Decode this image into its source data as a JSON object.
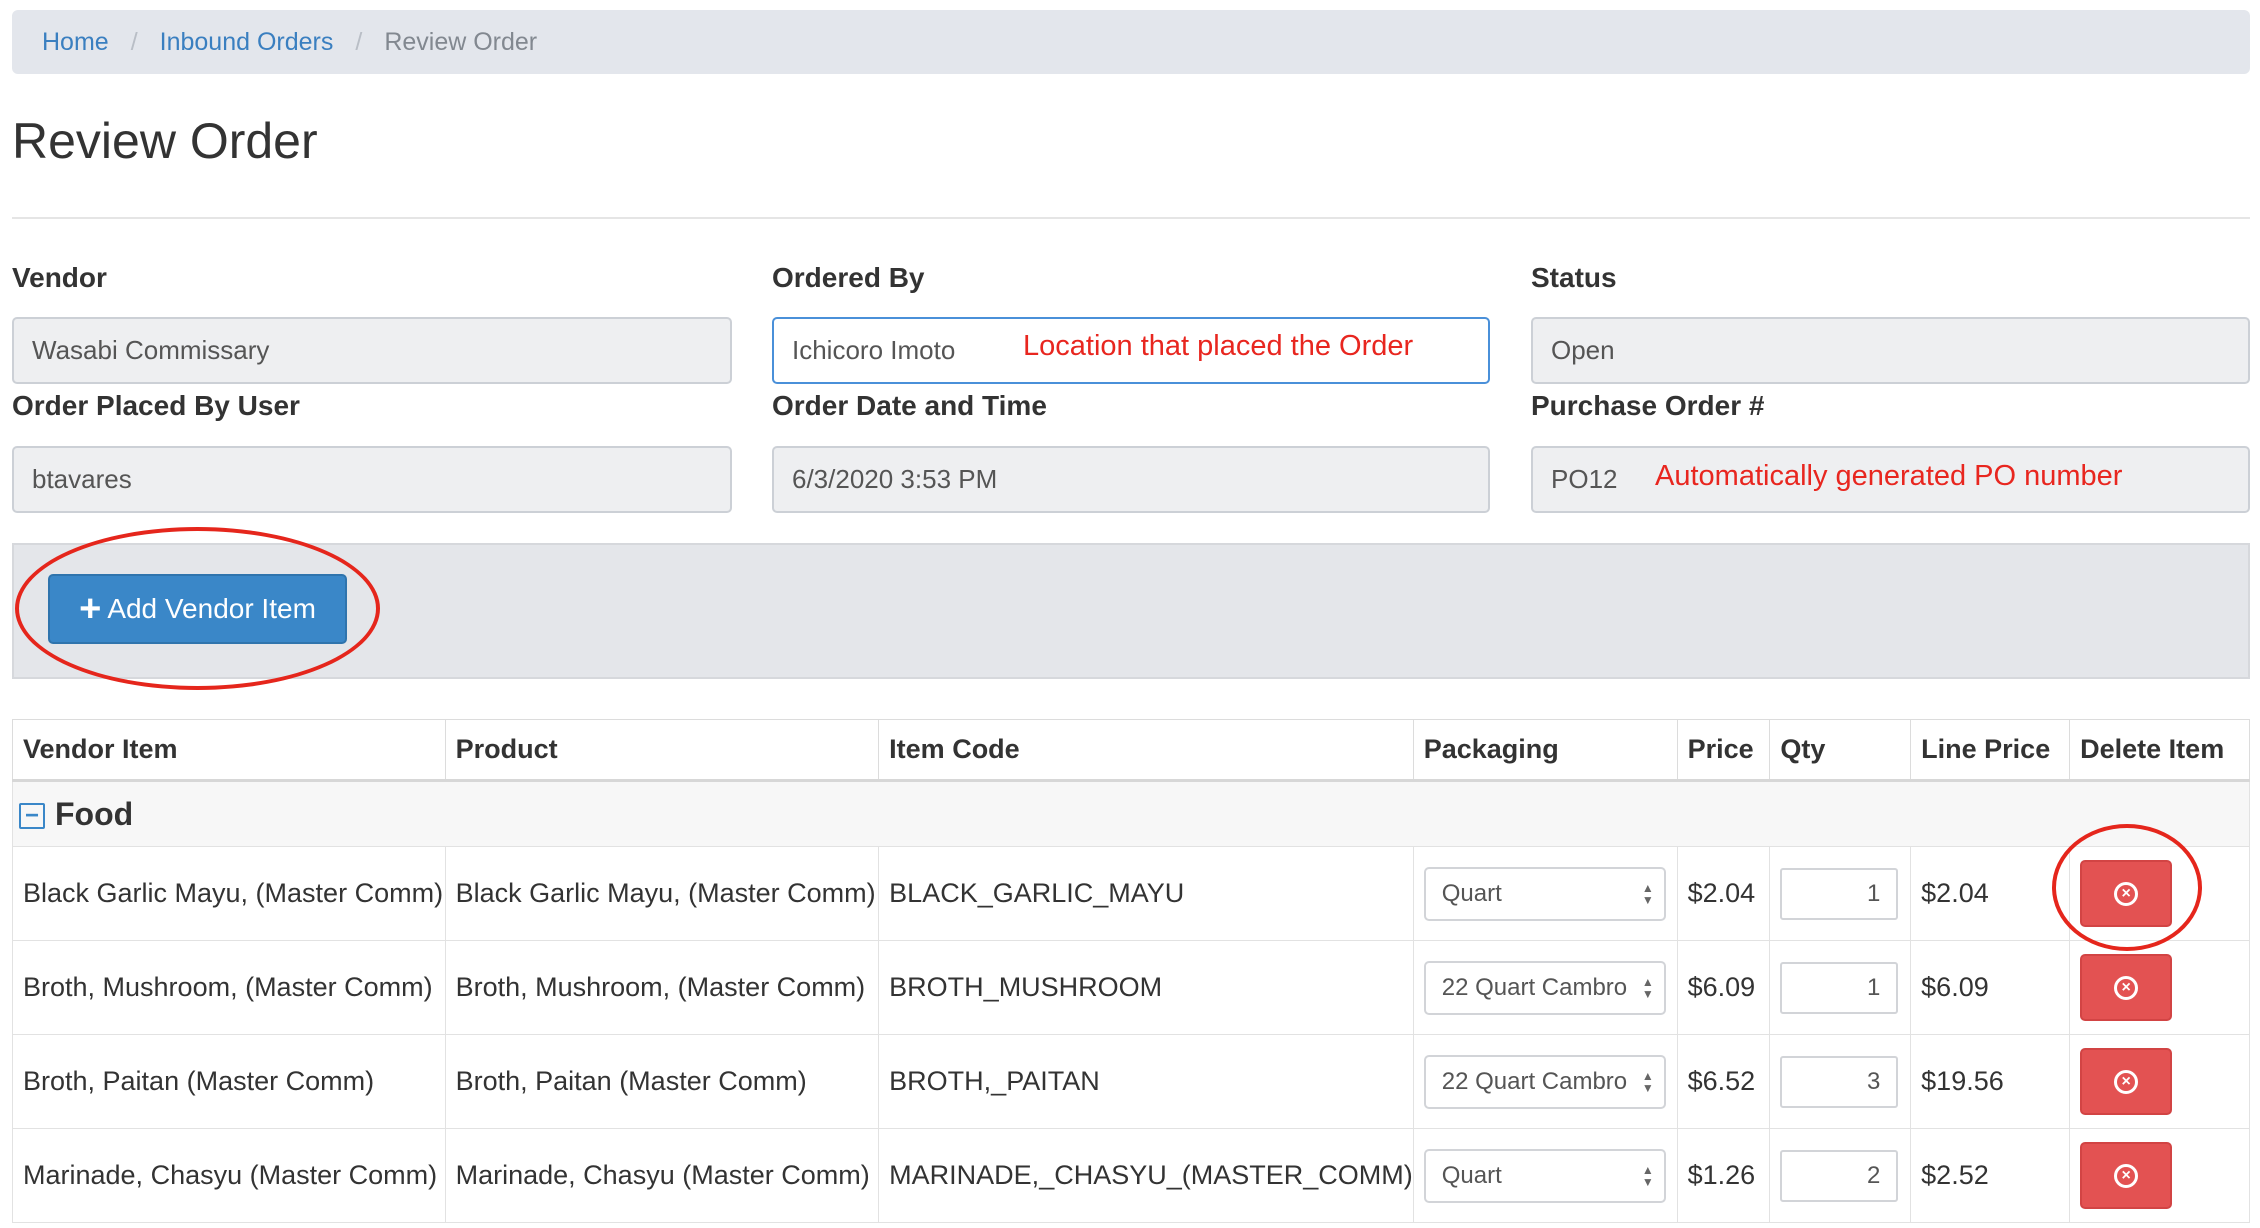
{
  "breadcrumb": {
    "home": "Home",
    "inbound": "Inbound Orders",
    "current": "Review Order",
    "sep": "/"
  },
  "page_title": "Review Order",
  "fields": {
    "vendor": {
      "label": "Vendor",
      "value": "Wasabi Commissary"
    },
    "ordered_by": {
      "label": "Ordered By",
      "value": "Ichicoro Imoto"
    },
    "status": {
      "label": "Status",
      "value": "Open"
    },
    "placed_by_user": {
      "label": "Order Placed By User",
      "value": "btavares"
    },
    "order_date": {
      "label": "Order Date and Time",
      "value": "6/3/2020 3:53 PM"
    },
    "po_number": {
      "label": "Purchase Order #",
      "value": "PO12"
    }
  },
  "annotations": {
    "ordered_by_note": "Location that placed the Order",
    "po_note": "Automatically generated PO number",
    "color": "#e8261f"
  },
  "toolbar": {
    "add_label": "Add Vendor Item",
    "add_icon": "plus-icon"
  },
  "table": {
    "headers": [
      "Vendor Item",
      "Product",
      "Item Code",
      "Packaging",
      "Price",
      "Qty",
      "Line Price",
      "Delete Item"
    ],
    "group": {
      "label": "Food",
      "icon": "minus-square-icon"
    },
    "rows": [
      {
        "vendor_item": "Black Garlic Mayu, (Master Comm)",
        "product": "Black Garlic Mayu, (Master Comm)",
        "item_code": "BLACK_GARLIC_MAYU",
        "packaging": "Quart",
        "price": "$2.04",
        "qty": "1",
        "line_price": "$2.04"
      },
      {
        "vendor_item": "Broth, Mushroom, (Master Comm)",
        "product": "Broth, Mushroom, (Master Comm)",
        "item_code": "BROTH_MUSHROOM",
        "packaging": "22 Quart Cambro",
        "price": "$6.09",
        "qty": "1",
        "line_price": "$6.09"
      },
      {
        "vendor_item": "Broth, Paitan (Master Comm)",
        "product": "Broth, Paitan (Master Comm)",
        "item_code": "BROTH,_PAITAN",
        "packaging": "22 Quart Cambro",
        "price": "$6.52",
        "qty": "3",
        "line_price": "$19.56"
      },
      {
        "vendor_item": "Marinade, Chasyu (Master Comm)",
        "product": "Marinade, Chasyu (Master Comm)",
        "item_code": "MARINADE,_CHASYU_(MASTER_COMM)",
        "packaging": "Quart",
        "price": "$1.26",
        "qty": "2",
        "line_price": "$2.52"
      }
    ]
  },
  "colors": {
    "link": "#3a7fc0",
    "primary_button": "#3a87c8",
    "danger_button": "#e35252",
    "highlight_circle": "#e5261c"
  }
}
